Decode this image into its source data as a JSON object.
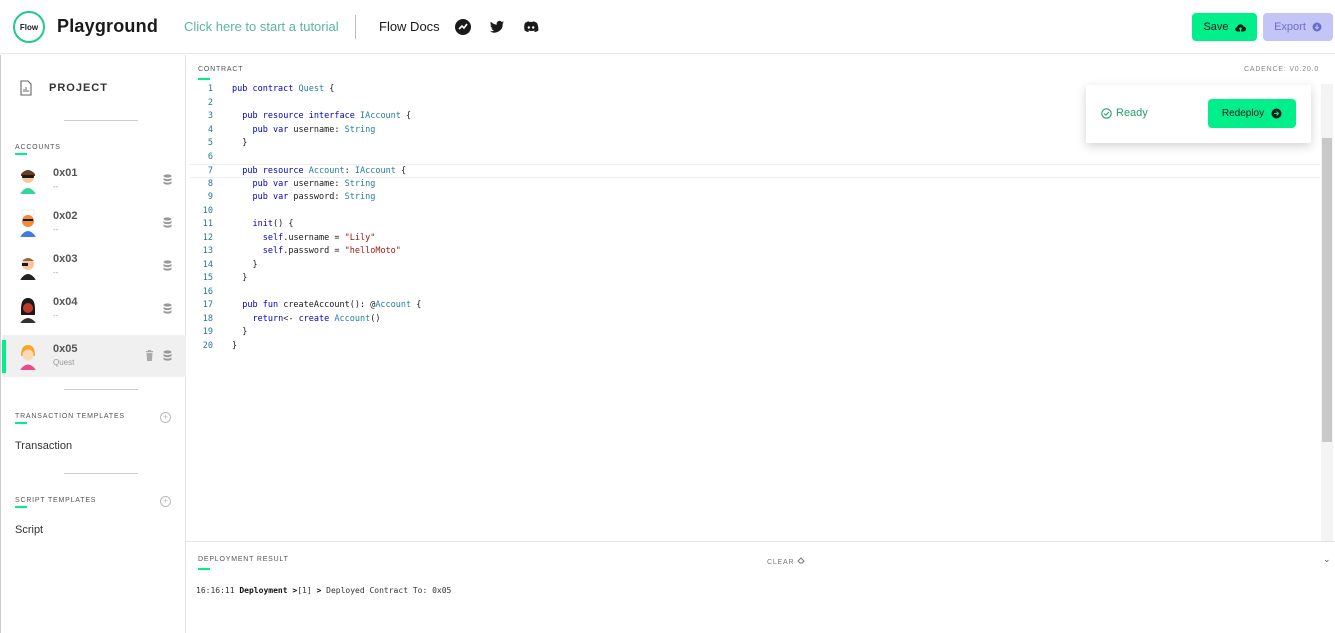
{
  "header": {
    "logo_text": "Flow",
    "title": "Playground",
    "tutorial_link": "Click here to start a tutorial",
    "docs_link": "Flow Docs",
    "save_label": "Save",
    "export_label": "Export"
  },
  "sidebar": {
    "project_label": "PROJECT",
    "accounts_label": "ACCOUNTS",
    "accounts": [
      {
        "address": "0x01",
        "subtitle": "--",
        "selected": false
      },
      {
        "address": "0x02",
        "subtitle": "--",
        "selected": false
      },
      {
        "address": "0x03",
        "subtitle": "--",
        "selected": false
      },
      {
        "address": "0x04",
        "subtitle": "--",
        "selected": false
      },
      {
        "address": "0x05",
        "subtitle": "Quest",
        "selected": true
      }
    ],
    "transaction_templates_label": "TRANSACTION TEMPLATES",
    "transaction_item": "Transaction",
    "script_templates_label": "SCRIPT TEMPLATES",
    "script_item": "Script"
  },
  "editor": {
    "label": "CONTRACT",
    "cadence_version": "CADENCE: V0.20.0",
    "active_line": 7,
    "lines": [
      "1",
      "2",
      "3",
      "4",
      "5",
      "6",
      "7",
      "8",
      "9",
      "10",
      "11",
      "12",
      "13",
      "14",
      "15",
      "16",
      "17",
      "18",
      "19",
      "20"
    ]
  },
  "status": {
    "ready_label": "Ready",
    "redeploy_label": "Redeploy"
  },
  "deployment": {
    "label": "DEPLOYMENT RESULT",
    "clear_label": "CLEAR",
    "log_time": "16:16:11",
    "log_kind": "Deployment",
    "log_ref": "[1]",
    "log_message": "Deployed Contract To: 0x05"
  },
  "colors": {
    "accent": "#00ef8b",
    "export_bg": "#c3c5f7",
    "ready": "#22a06b"
  }
}
